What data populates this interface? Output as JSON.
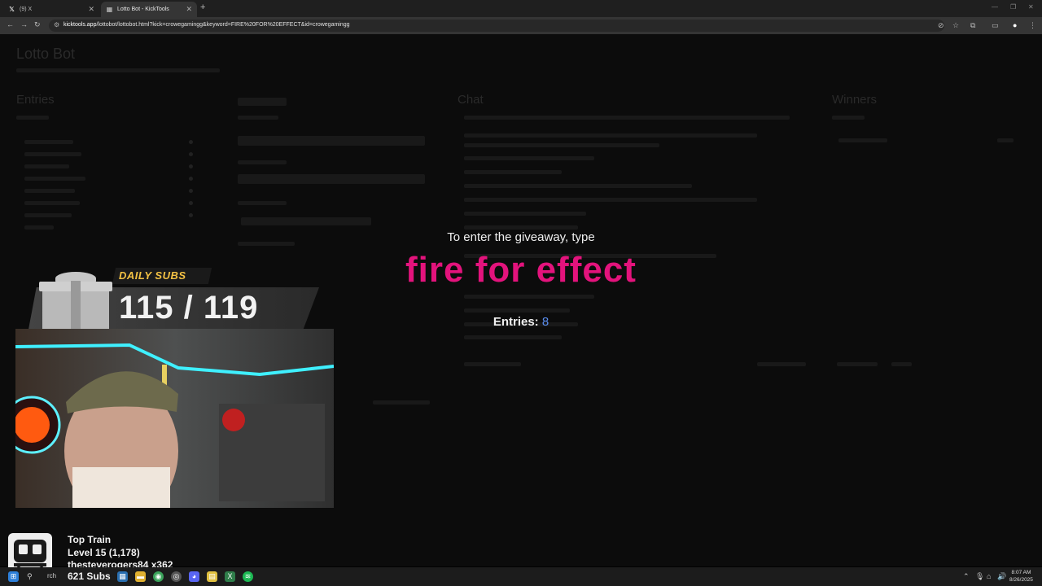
{
  "browser": {
    "tabs": [
      {
        "label": "(9) X",
        "icon": "x-logo-icon",
        "active": false
      },
      {
        "label": "Lotto Bot - KickTools",
        "icon": "kicktools-icon",
        "active": true
      }
    ],
    "url_host": "kicktools.app",
    "url_path": "/lottobot/lottobot.html?kick=crowegamingg&keyword=FIRE%20FOR%20EFFECT&id=crowegamingg"
  },
  "page": {
    "title": "Lotto Bot",
    "columns": [
      "Entries",
      "Chat",
      "Winners"
    ],
    "chat_heading": "Chat"
  },
  "giveaway": {
    "prompt": "To enter the giveaway, type",
    "keyword": "fire for effect",
    "entries_label": "Entries:",
    "entries_count": "8",
    "keyword_color": "#e3137c",
    "count_color": "#5a8ef0"
  },
  "daily_subs": {
    "label": "DAILY SUBS",
    "count": "115 / 119",
    "current": 115,
    "goal": 119,
    "label_color": "#f4c244"
  },
  "top_train": {
    "title": "Top Train",
    "level": "Level 15  (1,178)",
    "user": "thesteverogers84 x362",
    "subs": "621 Subs"
  },
  "taskbar": {
    "search_partial": "rch",
    "time": "8:07 AM",
    "date": "8/26/2025"
  }
}
